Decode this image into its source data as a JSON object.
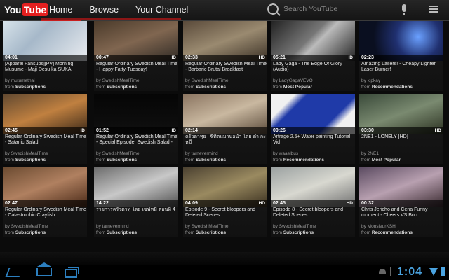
{
  "topbar": {
    "logo_you": "You",
    "logo_tube": "Tube",
    "tabs": [
      {
        "label": "Home"
      },
      {
        "label": "Browse"
      },
      {
        "label": "Your Channel"
      }
    ],
    "search_placeholder": "Search YouTube"
  },
  "videos": [
    {
      "duration": "04:01",
      "hd": "",
      "title": "[Apparel Fansubs][PV] Morning Musume - Maji Desu ka SUKA!",
      "channel": "by mutumethai",
      "from_prefix": "from",
      "from": "Subscriptions"
    },
    {
      "duration": "00:47",
      "hd": "HD",
      "title": "Regular Ordinary Swedish Meal Time - Happy Fatty-Tuesday!",
      "channel": "by SwedishMealTime",
      "from_prefix": "from",
      "from": "Subscriptions"
    },
    {
      "duration": "02:33",
      "hd": "HD",
      "title": "Regular Ordinary Swedish Meal Time - Barbaric Brutal Breakfast",
      "channel": "by SwedishMealTime",
      "from_prefix": "from",
      "from": "Subscriptions"
    },
    {
      "duration": "05:21",
      "hd": "HD",
      "title": "Lady Gaga - The Edge Of Glory (Audio)",
      "channel": "by LadyGagaVEVO",
      "from_prefix": "from",
      "from": "Most Popular"
    },
    {
      "duration": "02:23",
      "hd": "",
      "title": "Amazing Lasers! - Cheapy Lighter Laser Burner!",
      "channel": "by kipkay",
      "from_prefix": "from",
      "from": "Recommendations"
    },
    {
      "duration": "02:45",
      "hd": "HD",
      "title": "Regular Ordinary Swedish Meal Time - Satanic Salad",
      "channel": "by SwedishMealTime",
      "from_prefix": "from",
      "from": "Subscriptions"
    },
    {
      "duration": "01:52",
      "hd": "HD",
      "title": "Regular Ordinary Swedish Meal Time - Special Episode: Swedish Salad -",
      "channel": "by SwedishMealTime",
      "from_prefix": "from",
      "from": "Subscriptions"
    },
    {
      "duration": "02:14",
      "hd": "",
      "title": "ครัวตาทุย : ซีทิตหมานอนำ โดย ตำ กะ หมี",
      "channel": "by tarnevermind",
      "from_prefix": "from",
      "from": "Subscriptions"
    },
    {
      "duration": "00:26",
      "hd": "",
      "title": "Artrage 2.5+ Water painting Tutorial Vid",
      "channel": "by waaelbus",
      "from_prefix": "from",
      "from": "Recommendations"
    },
    {
      "duration": "03:30",
      "hd": "HD",
      "title": "2NE1 - LONELY [HD]",
      "channel": "by 2NE1",
      "from_prefix": "from",
      "from": "Most Popular"
    },
    {
      "duration": "02:47",
      "hd": "",
      "title": "Regular Ordinary Swedish Meal Time - Catastrophic Crayfish",
      "channel": "by SwedishMealTime",
      "from_prefix": "from",
      "from": "Subscriptions"
    },
    {
      "duration": "14:22",
      "hd": "",
      "title": "รายการครัวตาทุ โดย เซฟหมี ตอนที่ 4",
      "channel": "by tarnevermind",
      "from_prefix": "from",
      "from": "Subscriptions"
    },
    {
      "duration": "04:09",
      "hd": "HD",
      "title": "Episode 9 - Secret bloopers and Deleted Scenes",
      "channel": "by SwedishMealTime",
      "from_prefix": "from",
      "from": "Subscriptions"
    },
    {
      "duration": "02:45",
      "hd": "HD",
      "title": "Episode 8 - Secret bloopers and Deleted Scenes",
      "channel": "by SwedishMealTime",
      "from_prefix": "from",
      "from": "Subscriptions"
    },
    {
      "duration": "00:32",
      "hd": "",
      "title": "Chris Jericho and Cena Funny moment - Cheers VS Boo",
      "channel": "by MonsieurKSH",
      "from_prefix": "from",
      "from": "Recommendations"
    }
  ],
  "statusbar": {
    "clock": "1:04"
  },
  "colors": {
    "accent": "#c81e1e",
    "system_blue": "#4aa3e0"
  }
}
